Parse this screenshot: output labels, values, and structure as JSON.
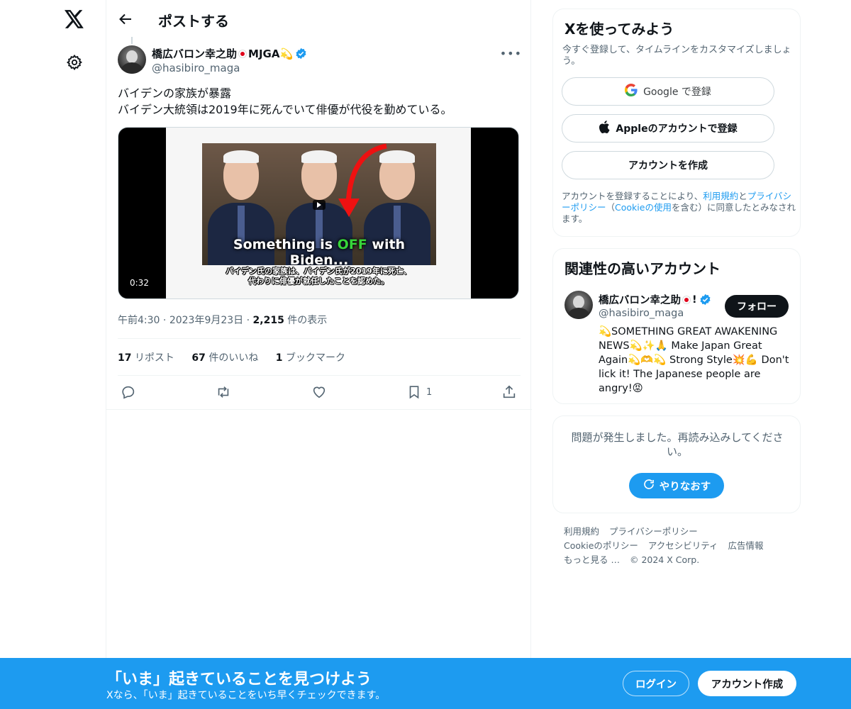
{
  "nav": {
    "logo": "x-logo-icon",
    "settings": "gear-icon"
  },
  "header": {
    "title": "ポストする"
  },
  "tweet": {
    "author_name": "橋広バロン幸之助",
    "author_tag": "MJGA💫",
    "author_handle": "@hasibiro_maga",
    "more": "•••",
    "text_line1": "バイデンの家族が暴露",
    "text_line2": "バイデン大統領は2019年に死んでいて俳優が代役を勤めている。",
    "video": {
      "caption_pre": "Something is ",
      "caption_off": "OFF",
      "caption_post": " with Biden...",
      "subtitle_line1": "バイデン氏の家族は、バイデン氏が2019年に死亡、",
      "subtitle_line2": "代わりに俳優が就任したことを認めた。",
      "duration": "0:32"
    },
    "time": "午前4:30",
    "date": "2023年9月23日",
    "views_count": "2,215",
    "views_label": "件の表示",
    "reposts_count": "17",
    "reposts_label": "リポスト",
    "likes_count": "67",
    "likes_label": "件のいいね",
    "bookmarks_count": "1",
    "bookmarks_label": "ブックマーク",
    "bookmark_action_count": "1"
  },
  "signup": {
    "title": "Xを使ってみよう",
    "desc": "今すぐ登録して、タイムラインをカスタマイズしましょう。",
    "google_label": "Google で登録",
    "apple_label": "Appleのアカウントで登録",
    "create_label": "アカウントを作成",
    "terms_pre": "アカウントを登録することにより、",
    "terms_link1": "利用規約",
    "terms_mid1": "と",
    "terms_link2": "プライバシーポリシー",
    "terms_mid2": "（",
    "terms_link3": "Cookieの使用",
    "terms_post": "を含む）に同意したとみなされます。"
  },
  "related": {
    "title": "関連性の高いアカウント",
    "name": "橋広バロン幸之助",
    "name_suffix": "!",
    "handle": "@hasibiro_maga",
    "follow_label": "フォロー",
    "bio": "💫SOMETHING GREAT AWAKENING NEWS💫✨🙏 Make Japan Great Again💫🫶💫 Strong Style💥💪 Don't lick it! The Japanese people are angry!😡"
  },
  "error": {
    "message": "問題が発生しました。再読み込みしてください。",
    "retry_label": "やりなおす"
  },
  "footer": {
    "links": [
      "利用規約",
      "プライバシーポリシー",
      "Cookieのポリシー",
      "アクセシビリティ",
      "広告情報",
      "もっと見る …",
      "© 2024 X Corp."
    ]
  },
  "bottombar": {
    "title": "「いま」起きていることを見つけよう",
    "subtitle": "Xなら、「いま」起きていることをいち早くチェックできます。",
    "login_label": "ログイン",
    "create_label": "アカウント作成"
  },
  "colors": {
    "accent": "#1d9bf0",
    "text": "#0f1419",
    "muted": "#536471",
    "flag": "#e0001a"
  }
}
